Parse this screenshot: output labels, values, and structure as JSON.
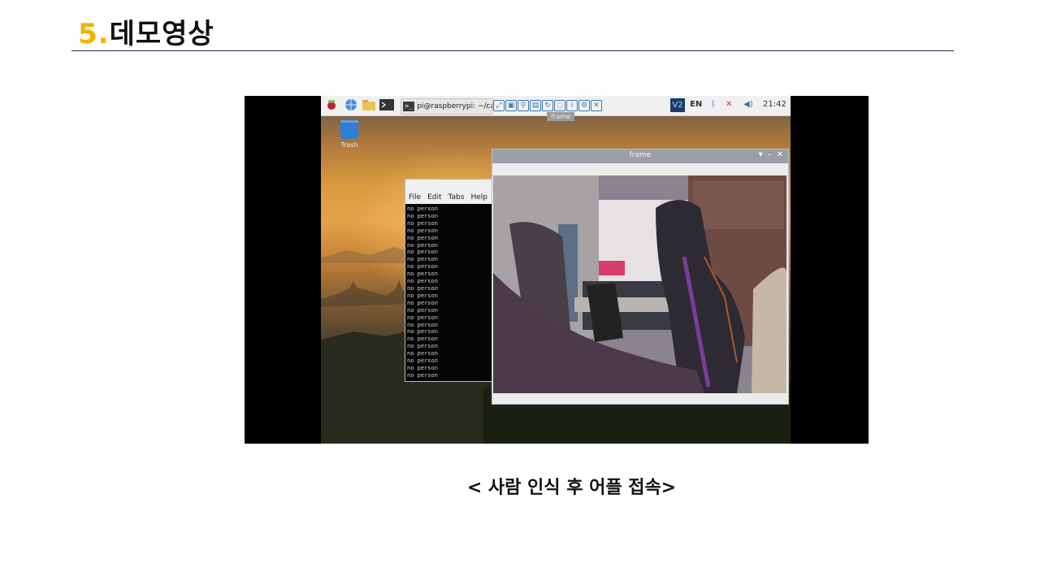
{
  "slide": {
    "number": "5.",
    "title": "데모영상",
    "caption": "< 사람 인식 후 어플 접속>"
  },
  "colors": {
    "accent": "#f0b400",
    "rule": "#1f2d44"
  },
  "desktop": {
    "taskbar": {
      "terminal_task_label": "pi@raspberrypi: ~/ca...",
      "vnc_label": "V2",
      "lang": "EN",
      "clock": "21:42",
      "icons": [
        "raspberry-menu-icon",
        "web-browser-icon",
        "file-manager-icon",
        "terminal-icon",
        "vnc-icon",
        "bluetooth-icon",
        "network-disconnected-icon",
        "volume-icon"
      ]
    },
    "ghost_tab_label": "frame",
    "trash_label": "Trash",
    "terminal": {
      "menu": [
        "File",
        "Edit",
        "Tabs",
        "Help"
      ],
      "lines": [
        "no person",
        "no person",
        "no person",
        "no person",
        "no person",
        "no person",
        "no person",
        "no person",
        "no person",
        "no person",
        "no person",
        "no person",
        "no person",
        "no person",
        "no person",
        "no person",
        "no person",
        "no person",
        "no person",
        "no person",
        "no person",
        "no person",
        "no person",
        "no person"
      ]
    },
    "frame_window": {
      "title": "frame",
      "controls": [
        "▾",
        "–",
        "✕"
      ]
    }
  }
}
